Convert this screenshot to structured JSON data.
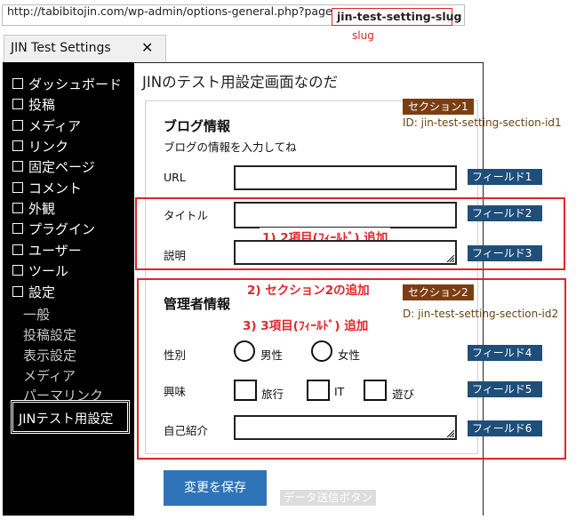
{
  "browser": {
    "url_prefix": "http://tabibitojin.com/wp-admin/options-general.php?page=",
    "url_slug": "jin-test-setting-slug",
    "slug_annotation": "slug",
    "tab_title": "JIN Test Settings",
    "tab_close": "✕"
  },
  "sidebar": {
    "items": [
      {
        "label": "ダッシュボード"
      },
      {
        "label": "投稿"
      },
      {
        "label": "メディア"
      },
      {
        "label": "リンク"
      },
      {
        "label": "固定ページ"
      },
      {
        "label": "コメント"
      },
      {
        "label": "外観"
      },
      {
        "label": "プラグイン"
      },
      {
        "label": "ユーザー"
      },
      {
        "label": "ツール"
      },
      {
        "label": "設定"
      }
    ],
    "sub_items": [
      {
        "label": "一般"
      },
      {
        "label": "投稿設定"
      },
      {
        "label": "表示設定"
      },
      {
        "label": "メディア"
      },
      {
        "label": "パーマリンク"
      }
    ],
    "active_sub": "JINテスト用設定"
  },
  "main": {
    "page_title": "JINのテスト用設定画面なのだ",
    "section1": {
      "title": "ブログ情報",
      "description": "ブログの情報を入力してね",
      "badge": "セクション1",
      "id_note": "ID: jin-test-setting-section-id1",
      "fields": [
        {
          "label": "URL",
          "badge": "フィールド1",
          "value": ""
        },
        {
          "label": "タイトル",
          "badge": "フィールド2",
          "value": ""
        },
        {
          "label": "説明",
          "badge": "フィールド3",
          "value": ""
        }
      ]
    },
    "annotation1": "1) 2項目(ﾌｨｰﾙﾄﾞ) 追加",
    "annotation2": "2) セクション2の追加",
    "annotation3": "3) 3項目(ﾌｨｰﾙﾄﾞ) 追加",
    "section2": {
      "title": "管理者情報",
      "badge": "セクション2",
      "id_note": "D: jin-test-setting-section-id2",
      "gender": {
        "label": "性別",
        "options": [
          "男性",
          "女性"
        ],
        "badge": "フィールド4"
      },
      "interests": {
        "label": "興味",
        "options": [
          "旅行",
          "IT",
          "遊び"
        ],
        "badge": "フィールド5"
      },
      "bio": {
        "label": "自己紹介",
        "badge": "フィールド6",
        "value": ""
      }
    },
    "save_button": "変更を保存",
    "save_note": "データ送信ボタン"
  },
  "colors": {
    "annotation_red": "#e0262b",
    "section_badge": "#7b3e13",
    "field_badge": "#1f4e79",
    "save_button": "#2f73b8",
    "sidebar_bg": "#000000"
  }
}
